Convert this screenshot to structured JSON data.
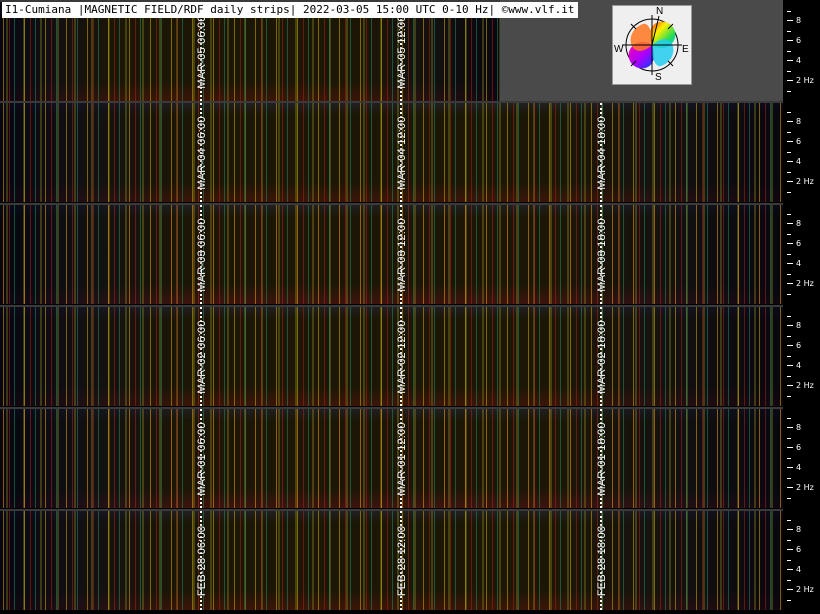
{
  "title": "I1-Cumiana |MAGNETIC FIELD/RDF daily strips| 2022-03-05 15:00 UTC 0-10 Hz| ©www.vlf.it",
  "compass": {
    "north": "N",
    "south": "S",
    "east": "E",
    "west": "W"
  },
  "axis_ticks": [
    "8",
    "6",
    "4",
    "2 Hz"
  ],
  "strips": [
    {
      "day": "MAR-05",
      "markers": [
        "MAR-05 06:00",
        "MAR-05 12:00"
      ]
    },
    {
      "day": "MAR-04",
      "markers": [
        "MAR-04 06:00",
        "MAR-04 12:00",
        "MAR-04 18:00"
      ]
    },
    {
      "day": "MAR-03",
      "markers": [
        "MAR-03 06:00",
        "MAR-03 12:00",
        "MAR-03 18:00"
      ]
    },
    {
      "day": "MAR-02",
      "markers": [
        "MAR-02 06:00",
        "MAR-02 12:00",
        "MAR-02 18:00"
      ]
    },
    {
      "day": "MAR-01",
      "markers": [
        "MAR-01 06:00",
        "MAR-01 12:00",
        "MAR-01 18:00"
      ]
    },
    {
      "day": "FEB-28",
      "markers": [
        "FEB-28 06:00",
        "FEB-28 12:00",
        "FEB-28 18:00"
      ]
    }
  ]
}
